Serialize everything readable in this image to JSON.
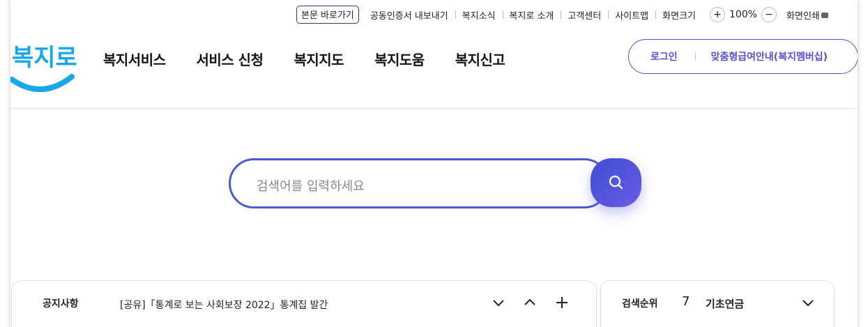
{
  "utility": {
    "skip_link": "본문 바로가기",
    "links": [
      "공동인증서 내보내기",
      "복지소식",
      "복지로 소개",
      "고객센터",
      "사이트맵",
      "화면크기"
    ],
    "zoom_in": "+",
    "zoom_level": "100%",
    "zoom_out": "−",
    "print_label": "화면인쇄"
  },
  "logo": {
    "text": "복지로",
    "color": "#1aa7e8"
  },
  "nav": {
    "items": [
      "복지서비스",
      "서비스 신청",
      "복지지도",
      "복지도움",
      "복지신고"
    ]
  },
  "member": {
    "login": "로그인",
    "membership": "맞춤형급여안내(복지멤버십)"
  },
  "search": {
    "placeholder": "검색어를 입력하세요",
    "button_icon": "search-icon"
  },
  "notice": {
    "label": "공지사항",
    "text": "[공유]「통계로 보는 사회보장 2022」통계집 발간"
  },
  "ranking": {
    "label": "검색순위",
    "rank": "7",
    "term": "기초연금"
  },
  "colors": {
    "accent": "#4a5bd0",
    "purple": "#5a4fcf",
    "logo_blue": "#1aa7e8"
  }
}
